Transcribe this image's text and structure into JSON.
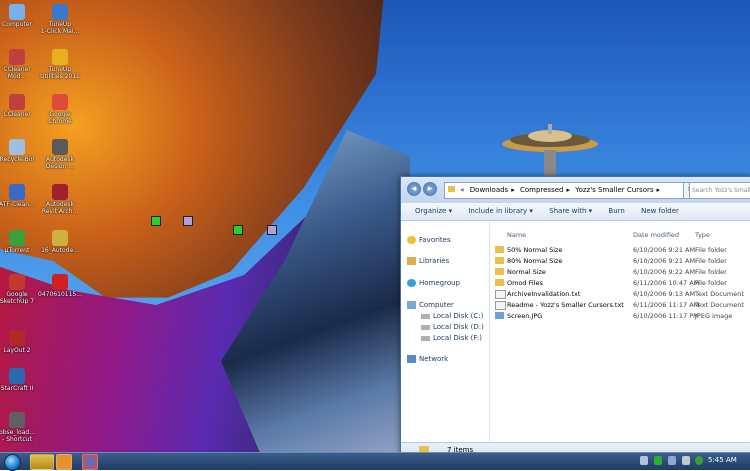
{
  "desktop": {
    "icons": [
      {
        "name": "computer",
        "label": "Computer",
        "color": "#7ab0e8"
      },
      {
        "name": "tuneup-1-click",
        "label": "TuneUp\n1-Click Mai...",
        "color": "#3a78c8"
      },
      {
        "name": "ccleaner-mod",
        "label": "CCleaner\nMod...",
        "color": "#c04040"
      },
      {
        "name": "tuneup-utilities",
        "label": "TuneUp\nUtilities 2011",
        "color": "#e8b020"
      },
      {
        "name": "ccleaner",
        "label": "CCleaner",
        "color": "#c04040"
      },
      {
        "name": "google-chrome",
        "label": "Google\nChrome",
        "color": "#e04a3a"
      },
      {
        "name": "recycle-bin",
        "label": "Recycle Bin",
        "color": "#9cc0e0"
      },
      {
        "name": "autodesk-design",
        "label": "Autodesk\nDesign ...",
        "color": "#5a5a5a"
      },
      {
        "name": "atf-cleaner",
        "label": "ATF-Clean...",
        "color": "#3a6ac8"
      },
      {
        "name": "autodesk-revit",
        "label": "Autodesk\nRevit Arch...",
        "color": "#a02030"
      },
      {
        "name": "utorrent",
        "label": "µTorrent",
        "color": "#3aa03a"
      },
      {
        "name": "autode-file",
        "label": "16_Autode...",
        "color": "#d0b040"
      },
      {
        "name": "google-sketchup",
        "label": "Google\nSketchUp 7",
        "color": "#c03a30"
      },
      {
        "name": "pdf-file",
        "label": "0470610115...",
        "color": "#d02020"
      },
      {
        "name": "layout",
        "label": "LayOut 2",
        "color": "#b02a2a"
      },
      {
        "name": "starcraft",
        "label": "StarCraft II",
        "color": "#2a6ab0"
      },
      {
        "name": "obse-loader",
        "label": "obse_load...\n- Shortcut",
        "color": "#606060"
      }
    ]
  },
  "explorer": {
    "address": [
      "Downloads",
      "Compressed",
      "Yozz's Smaller Cursors"
    ],
    "search_placeholder": "Search Yozz's Smaller Cursors",
    "toolbar": [
      "Organize ▾",
      "Include in library ▾",
      "Share with ▾",
      "Burn",
      "New folder"
    ],
    "nav": {
      "favorites": "Favorites",
      "libraries": "Libraries",
      "homegroup": "Homegroup",
      "computer": "Computer",
      "disks": [
        "Local Disk (C:)",
        "Local Disk (D:)",
        "Local Disk (F:)"
      ],
      "network": "Network"
    },
    "columns": {
      "name": "Name",
      "date": "Date modified",
      "type": "Type"
    },
    "files": [
      {
        "name": "50% Normal Size",
        "date": "6/10/2006 9:21 AM",
        "type": "File folder",
        "kind": "folder"
      },
      {
        "name": "80% Normal Size",
        "date": "6/10/2006 9:21 AM",
        "type": "File folder",
        "kind": "folder"
      },
      {
        "name": "Normal Size",
        "date": "6/10/2006 9:22 AM",
        "type": "File folder",
        "kind": "folder"
      },
      {
        "name": "Omod Files",
        "date": "6/11/2006 10:47 AM",
        "type": "File folder",
        "kind": "folder"
      },
      {
        "name": "ArchiveInvalidation.txt",
        "date": "6/10/2006 9:13 AM",
        "type": "Text Document",
        "kind": "txt"
      },
      {
        "name": "Readme - Yozz's Smaller Cursors.txt",
        "date": "6/11/2006 11:17 AM",
        "type": "Text Document",
        "kind": "txt"
      },
      {
        "name": "Screen.JPG",
        "date": "6/10/2006 11:17 PM",
        "type": "JPEG image",
        "kind": "jpg"
      }
    ],
    "status": "7 items"
  },
  "taskbar": {
    "clock": "5:45 AM"
  },
  "colors": {
    "folder": "#e8c04a",
    "txt": "#f4f4f4",
    "jpg": "#6aa0d8",
    "cursor_green": "#2ad02a",
    "cursor_purple": "#b0a0d8"
  }
}
